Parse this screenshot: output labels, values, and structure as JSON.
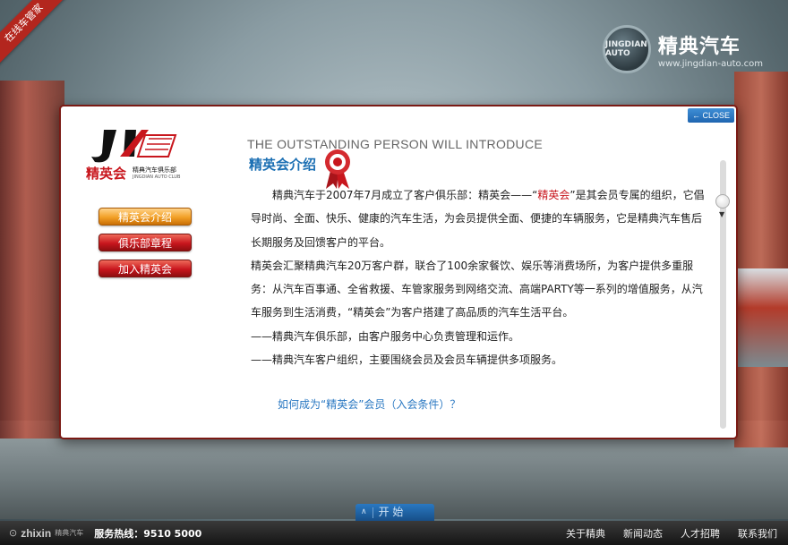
{
  "corner_ribbon": "在线车管家",
  "brand": {
    "badge_text": "JINGDIAN AUTO",
    "name": "精典汽车",
    "url": "www.jingdian-auto.com"
  },
  "modal": {
    "close_label": "CLOSE",
    "logo": {
      "name": "精英会",
      "sub1": "精典汽车俱乐部",
      "sub2": "JINGDIAN AUTO CLUB"
    },
    "menu": [
      {
        "label": "精英会介绍",
        "active": true
      },
      {
        "label": "俱乐部章程",
        "active": false
      },
      {
        "label": "加入精英会",
        "active": false
      }
    ],
    "heading_en": "THE OUTSTANDING PERSON WILL INTRODUCE",
    "heading_cn": "精英会介绍",
    "para1_a": "精典汽车于2007年7月成立了客户俱乐部：精英会——“",
    "para1_hl": "精英会",
    "para1_b": "”是其会员专属的组织，它倡导时尚、全面、快乐、健康的汽车生活，为会员提供全面、便捷的车辆服务，它是精典汽车售后长期服务及回馈客户的平台。",
    "para2": "精英会汇聚精典汽车20万客户群，联合了100余家餐饮、娱乐等消费场所，为客户提供多重服务：从汽车百事通、全省救援、车管家服务到网络交流、高端PARTY等一系列的增值服务，从汽车服务到生活消费，“精英会”为客户搭建了高品质的汽车生活平台。",
    "para3": "——精典汽车俱乐部，由客户服务中心负责管理和运作。",
    "para4": "——精典汽车客户组织，主要围绕会员及会员车辆提供多项服务。",
    "how_link": "如何成为“精英会”会员（入会条件）？"
  },
  "start_button": "开 始",
  "footer": {
    "logo_text": "zhixin",
    "logo_sub": "精典汽车",
    "hotline": "服务热线：9510 5000",
    "links": [
      "关于精典",
      "新闻动态",
      "人才招聘",
      "联系我们"
    ]
  },
  "colors": {
    "accent_red": "#c8161d",
    "link_blue": "#2a78c2",
    "close_blue": "#1f65b0",
    "active_orange": "#f2a026"
  }
}
